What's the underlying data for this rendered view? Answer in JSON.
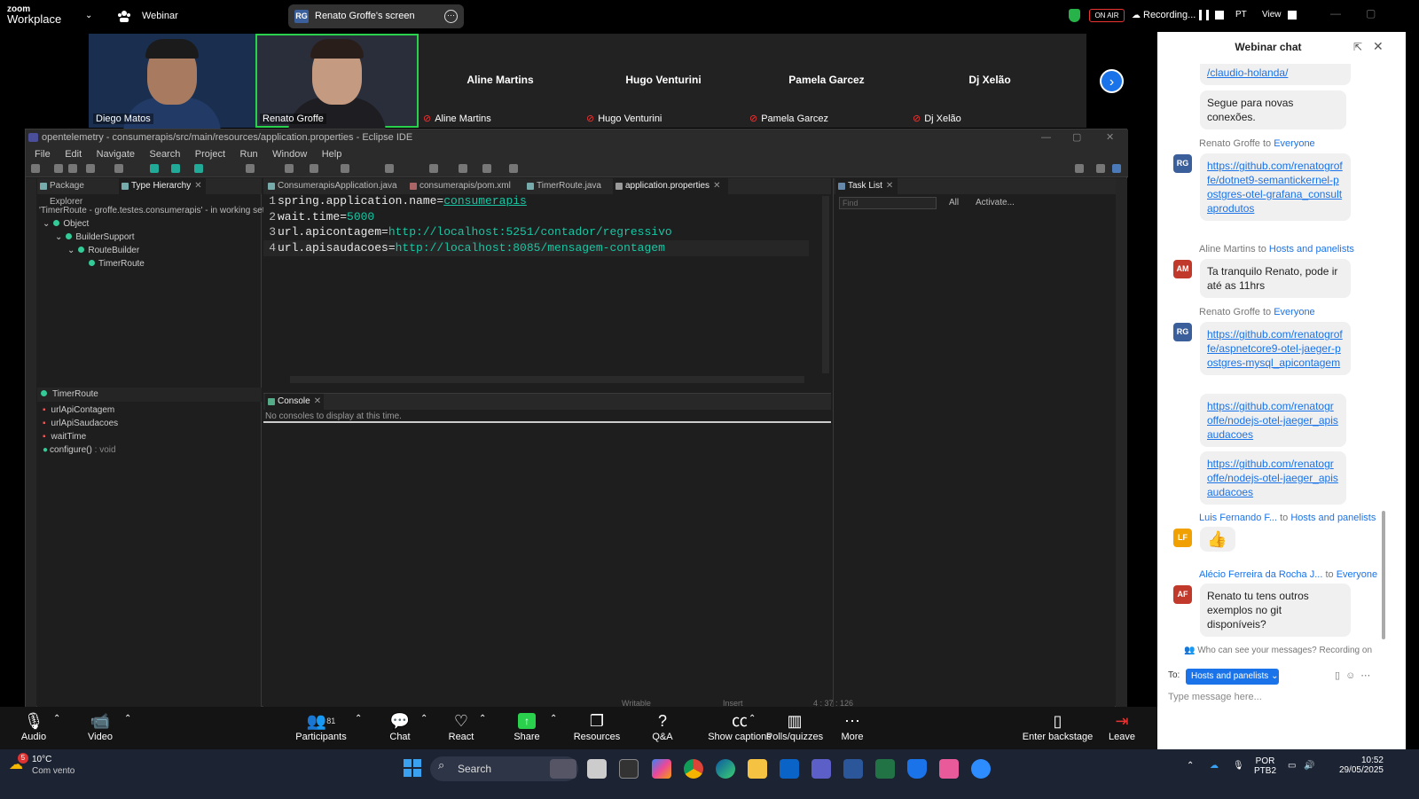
{
  "zoom": {
    "logo_small": "zoom",
    "logo_large": "Workplace",
    "webinar_label": "Webinar",
    "screen_pill_initials": "RG",
    "screen_pill_text": "Renato Groffe's screen",
    "on_air": "ON AIR",
    "recording": "Recording...",
    "language": "PT",
    "view": "View"
  },
  "gallery": {
    "tiles": [
      {
        "name": "Diego Matos",
        "video": true
      },
      {
        "name": "Renato Groffe",
        "video": true,
        "active": true
      },
      {
        "name": "Aline Martins",
        "video": false,
        "muted": true
      },
      {
        "name": "Hugo Venturini",
        "video": false,
        "muted": true
      },
      {
        "name": "Pamela Garcez",
        "video": false,
        "muted": true
      },
      {
        "name": "Dj Xelão",
        "video": false,
        "muted": true
      }
    ]
  },
  "eclipse": {
    "title": "opentelemetry - consumerapis/src/main/resources/application.properties - Eclipse IDE",
    "menu": [
      "File",
      "Edit",
      "Navigate",
      "Search",
      "Project",
      "Run",
      "Window",
      "Help"
    ],
    "left_tabs": [
      "Package Explorer",
      "Type Hierarchy"
    ],
    "hierarchy_caption": "'TimerRoute - groffe.testes.consumerapis' - in working set:",
    "tree": [
      "Object",
      "BuilderSupport",
      "RouteBuilder",
      "TimerRoute"
    ],
    "members_title": "TimerRoute",
    "members": [
      "urlApiContagem",
      "urlApiSaudacoes",
      "waitTime",
      "configure()"
    ],
    "member_return": " : void",
    "editor_tabs": [
      "ConsumerapisApplication.java",
      "consumerapis/pom.xml",
      "TimerRoute.java",
      "application.properties"
    ],
    "code": [
      {
        "num": "1",
        "key": "spring.application.name=",
        "value": "consumerapis"
      },
      {
        "num": "2",
        "key": "wait.time=",
        "value": "5000"
      },
      {
        "num": "3",
        "key": "url.apicontagem=",
        "value": "http://localhost:5251/contador/regressivo"
      },
      {
        "num": "4",
        "key": "url.apisaudacoes=",
        "value": "http://localhost:8085/mensagem-contagem"
      }
    ],
    "console_tab": "Console",
    "console_msg": "No consoles to display at this time.",
    "task_tab": "Task List",
    "find_placeholder": "Find",
    "task_all": "All",
    "task_activate": "Activate...",
    "status_writable": "Writable",
    "status_insert": "Insert",
    "status_pos": "4 : 37 : 126"
  },
  "toolbar": {
    "audio": "Audio",
    "video": "Video",
    "participants": "Participants",
    "participants_count": "81",
    "chat": "Chat",
    "react": "React",
    "share": "Share",
    "resources": "Resources",
    "qa": "Q&A",
    "captions": "Show captions",
    "polls": "Polls/quizzes",
    "more": "More",
    "backstage": "Enter backstage",
    "leave": "Leave"
  },
  "chat": {
    "title": "Webinar chat",
    "prev_link": "/claudio-holanda/",
    "prev_text": "Segue para novas conexões.",
    "messages": [
      {
        "from": "Renato Groffe",
        "to": "Everyone",
        "initials": "RG",
        "color": "#3b5f9a",
        "text": "https://github.com/renatogroffe/dotnet9-semantickernel-postgres-otel-grafana_consultaprodutos"
      },
      {
        "from": "Aline Martins",
        "to": "Hosts and panelists",
        "initials": "AM",
        "color": "#c0392b",
        "text": "Ta tranquilo Renato, pode ir até as 11hrs"
      },
      {
        "from": "Renato Groffe",
        "to": "Everyone",
        "initials": "RG",
        "color": "#3b5f9a",
        "text": "https://github.com/renatogroffe/aspnetcore9-otel-jaeger-postgres-mysql_apicontagem"
      },
      {
        "text2": "https://github.com/renatogroffe/nodejs-otel-jaeger_apisaudacoes"
      },
      {
        "text3": "https://github.com/renatogroffe/nodejs-otel-jaeger_apisaudacoes"
      },
      {
        "from": "Luis Fernando F...",
        "to": "Hosts and panelists",
        "initials": "LF",
        "color": "#f0a000",
        "text": "👍"
      },
      {
        "from": "Alécio Ferreira da Rocha J...",
        "to": "Everyone",
        "initials": "AF",
        "color": "#c0392b",
        "text": "Renato tu tens outros exemplos no git disponíveis?"
      }
    ],
    "notice": "Who can see your messages? Recording on",
    "to_label": "To:",
    "to_value": "Hosts and panelists",
    "placeholder": "Type message here..."
  },
  "taskbar": {
    "weather_temp": "10°C",
    "weather_desc": "Com vento",
    "weather_badge": "5",
    "search": "Search",
    "lang1": "POR",
    "lang2": "PTB2",
    "time": "10:52",
    "date": "29/05/2025"
  }
}
